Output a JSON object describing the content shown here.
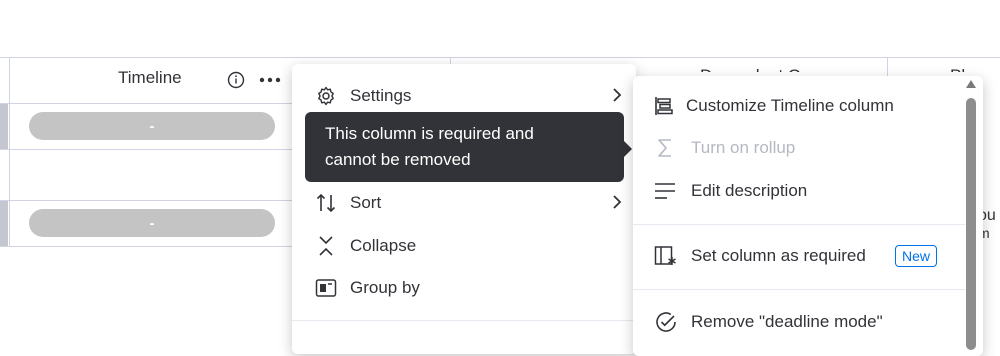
{
  "board": {
    "timeline_header": "Timeline",
    "next_header_partial": "Dependent On",
    "last_header_partial": "Planned E",
    "pill_text": "-",
    "partial_cell_text_1": "ou",
    "partial_cell_text_2": "m"
  },
  "column_menu": {
    "items": [
      {
        "label": "Settings",
        "icon": "gear-icon",
        "has_submenu": true
      },
      {
        "label": "Sort",
        "icon": "sort-icon",
        "has_submenu": true
      },
      {
        "label": "Collapse",
        "icon": "collapse-icon",
        "has_submenu": false
      },
      {
        "label": "Group by",
        "icon": "group-by-icon",
        "has_submenu": false
      }
    ]
  },
  "tooltip": {
    "line1": "This column is required and",
    "line2": "cannot be removed"
  },
  "settings_submenu": {
    "items": [
      {
        "label": "Customize Timeline column",
        "icon": "timeline-icon",
        "enabled": true
      },
      {
        "label": "Turn on rollup",
        "icon": "sigma-icon",
        "enabled": false
      },
      {
        "label": "Edit description",
        "icon": "description-icon",
        "enabled": true
      },
      {
        "label": "Set column as required",
        "icon": "required-column-icon",
        "enabled": true,
        "badge": "New"
      },
      {
        "label": "Remove \"deadline mode\"",
        "icon": "check-circle-icon",
        "enabled": true
      }
    ]
  },
  "colors": {
    "tooltip_bg": "#323338",
    "badge_accent": "#0073ea",
    "pill_gray": "#c4c4c4",
    "disabled_text": "#b5b8c2"
  }
}
